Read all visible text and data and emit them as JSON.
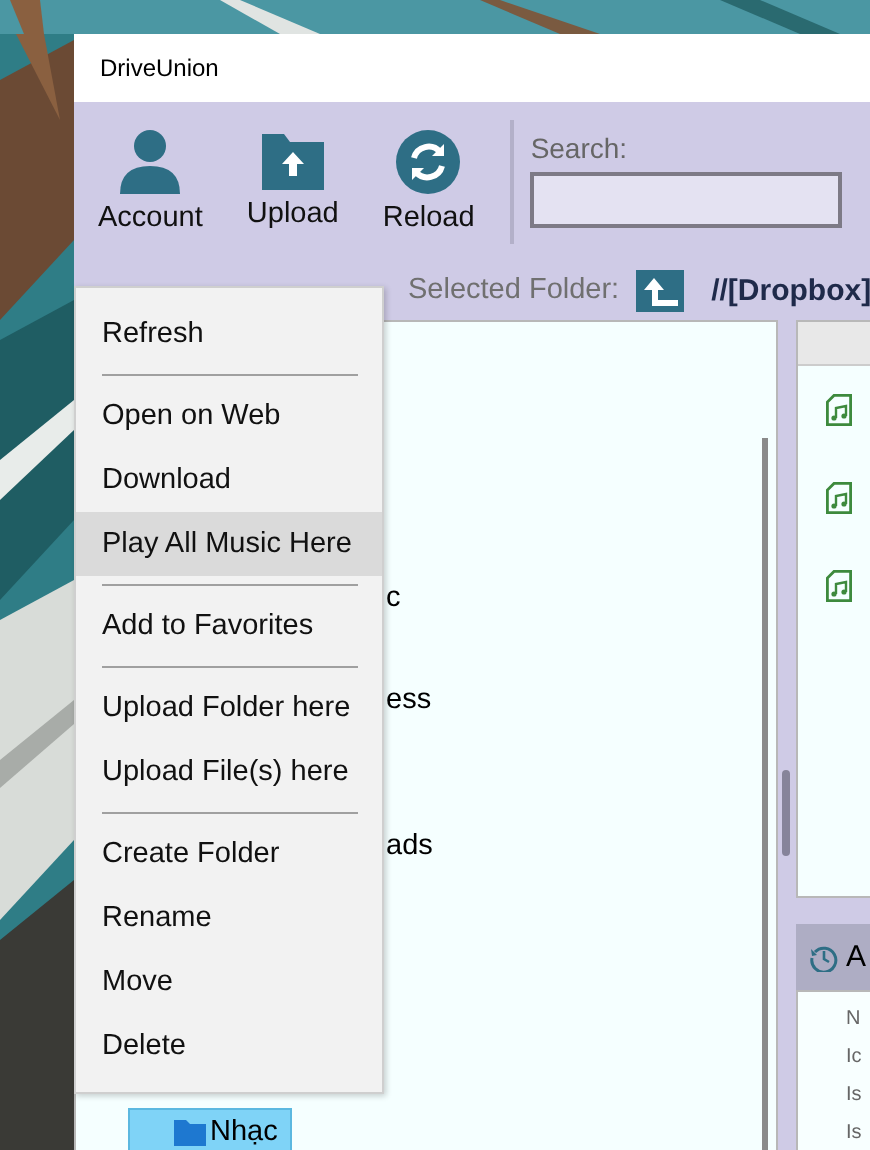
{
  "window": {
    "title": "DriveUnion"
  },
  "toolbar": {
    "buttons": [
      {
        "label": "Account",
        "kind": "account"
      },
      {
        "label": "Upload",
        "kind": "upload"
      },
      {
        "label": "Reload",
        "kind": "reload"
      }
    ],
    "search": {
      "label": "Search:"
    }
  },
  "location": {
    "label": "Selected Folder:",
    "path": "//[Dropbox]"
  },
  "folder_tree": {
    "items": [
      {
        "label": "c",
        "selected": false
      },
      {
        "label": "ess",
        "selected": false
      },
      {
        "label": "ads",
        "selected": false
      },
      {
        "label": "Nhạc",
        "selected": true
      }
    ]
  },
  "file_list": {
    "items": [
      {
        "kind": "music"
      },
      {
        "kind": "music"
      },
      {
        "kind": "music"
      }
    ]
  },
  "activity_panel": {
    "title": "A",
    "lines": [
      "N",
      "Ic",
      "Is",
      "Is"
    ]
  },
  "context_menu": {
    "groups": [
      {
        "items": [
          {
            "label": "Refresh",
            "selected": false
          }
        ]
      },
      {
        "items": [
          {
            "label": "Open on Web",
            "selected": false
          },
          {
            "label": "Download",
            "selected": false
          },
          {
            "label": "Play All Music Here",
            "selected": true
          }
        ]
      },
      {
        "items": [
          {
            "label": "Add to Favorites",
            "selected": false
          }
        ]
      },
      {
        "items": [
          {
            "label": "Upload Folder here",
            "selected": false
          },
          {
            "label": "Upload File(s) here",
            "selected": false
          }
        ]
      },
      {
        "items": [
          {
            "label": "Create Folder",
            "selected": false
          },
          {
            "label": "Rename",
            "selected": false
          },
          {
            "label": "Move",
            "selected": false
          },
          {
            "label": "Delete",
            "selected": false
          }
        ]
      }
    ]
  }
}
